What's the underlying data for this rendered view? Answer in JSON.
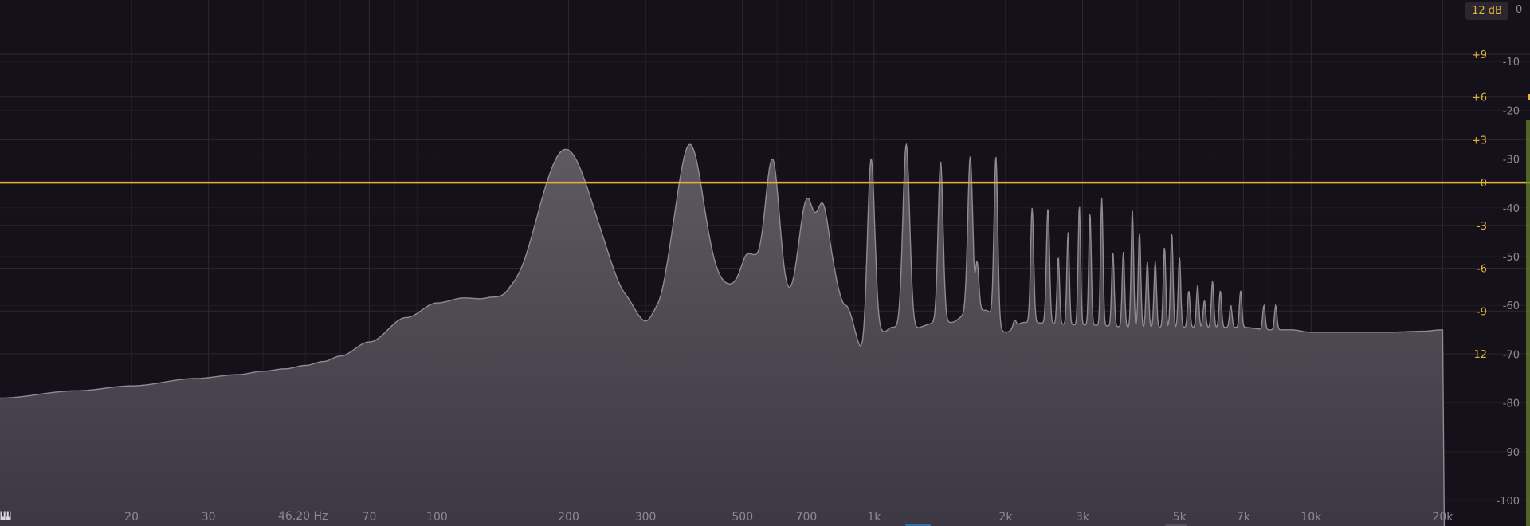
{
  "range_button": {
    "label": "12 dB"
  },
  "cursor_readout": {
    "label": "46.20 Hz"
  },
  "colors": {
    "background": "#15111a",
    "accent": "#e3b23c",
    "spectrum_fill_top": "#5e5a63",
    "spectrum_fill_bottom": "#3c3843",
    "spectrum_line": "#8f8b95",
    "grid": "#2c2932",
    "meter": "#6b8a2a"
  },
  "icons": {
    "piano": "piano-keys-icon"
  },
  "chart_data": {
    "type": "area",
    "x_scale": "log",
    "xlim": [
      10,
      21000
    ],
    "frequency_ticks": [
      {
        "hz": 20,
        "label": "20"
      },
      {
        "hz": 30,
        "label": "30"
      },
      {
        "hz": 70,
        "label": "70"
      },
      {
        "hz": 100,
        "label": "100"
      },
      {
        "hz": 200,
        "label": "200"
      },
      {
        "hz": 300,
        "label": "300"
      },
      {
        "hz": 500,
        "label": "500"
      },
      {
        "hz": 700,
        "label": "700"
      },
      {
        "hz": 1000,
        "label": "1k"
      },
      {
        "hz": 2000,
        "label": "2k"
      },
      {
        "hz": 3000,
        "label": "3k"
      },
      {
        "hz": 5000,
        "label": "5k"
      },
      {
        "hz": 7000,
        "label": "7k"
      },
      {
        "hz": 10000,
        "label": "10k"
      },
      {
        "hz": 20000,
        "label": "20k"
      }
    ],
    "minor_freq_grid": [
      40,
      50,
      60,
      80,
      90,
      400,
      600,
      800,
      900,
      4000,
      6000,
      8000,
      9000
    ],
    "gain_scale": {
      "range": [
        -12,
        12
      ],
      "ticks": [
        {
          "db": 9,
          "label": "+9"
        },
        {
          "db": 6,
          "label": "+6"
        },
        {
          "db": 3,
          "label": "+3"
        },
        {
          "db": 0,
          "label": "0"
        },
        {
          "db": -3,
          "label": "-3"
        },
        {
          "db": -6,
          "label": "-6"
        },
        {
          "db": -9,
          "label": "-9"
        },
        {
          "db": -12,
          "label": "-12"
        }
      ]
    },
    "level_scale": {
      "range": [
        -105,
        0
      ],
      "top_label": "0",
      "ticks": [
        {
          "db": -10,
          "label": "-10"
        },
        {
          "db": -20,
          "label": "-20"
        },
        {
          "db": -30,
          "label": "-30"
        },
        {
          "db": -40,
          "label": "-40"
        },
        {
          "db": -50,
          "label": "-50"
        },
        {
          "db": -60,
          "label": "-60"
        },
        {
          "db": -70,
          "label": "-70"
        },
        {
          "db": -80,
          "label": "-80"
        },
        {
          "db": -90,
          "label": "-90"
        },
        {
          "db": -100,
          "label": "-100"
        }
      ]
    },
    "eq_curve_gain_db": 0,
    "spectrum": {
      "floor_hz": [
        10,
        15,
        20,
        28,
        35,
        40,
        45,
        50,
        55,
        60,
        70,
        85,
        100,
        115,
        130,
        145,
        160,
        180,
        235,
        270,
        300,
        320,
        350,
        500,
        520,
        570,
        600,
        650,
        800,
        860,
        950,
        1050,
        1100,
        1200,
        1400,
        1500,
        1650,
        1800,
        2000,
        2200,
        3000,
        4000,
        5000,
        6000,
        7000,
        8000,
        9000,
        10000,
        12000,
        15000,
        18000,
        20000
      ],
      "floor_db": [
        -79,
        -77.5,
        -76.5,
        -75,
        -74.2,
        -73.5,
        -73,
        -72.3,
        -71.5,
        -70.4,
        -67.5,
        -62.5,
        -59.5,
        -58.5,
        -59,
        -60.5,
        -62,
        -61,
        -58,
        -61,
        -64,
        -62.2,
        -58.5,
        -56,
        -52.5,
        -56,
        -61.5,
        -60.5,
        -55,
        -60,
        -70,
        -65.5,
        -64.5,
        -65,
        -63.5,
        -63.5,
        -61.5,
        -61,
        -65.5,
        -63.5,
        -64,
        -64.5,
        -64.5,
        -64.5,
        -64.5,
        -65,
        -65,
        -65.5,
        -65.5,
        -65.5,
        -65.3,
        -65
      ],
      "peaks": [
        {
          "hz": 197,
          "db": -28,
          "width": 0.09
        },
        {
          "hz": 379,
          "db": -27,
          "width": 0.045
        },
        {
          "hz": 515,
          "db": -49.5,
          "width": 0.022
        },
        {
          "hz": 585,
          "db": -30,
          "width": 0.024
        },
        {
          "hz": 705,
          "db": -38,
          "width": 0.028
        },
        {
          "hz": 760,
          "db": -39,
          "width": 0.022
        },
        {
          "hz": 985,
          "db": -30,
          "width": 0.012
        },
        {
          "hz": 1185,
          "db": -27,
          "width": 0.011
        },
        {
          "hz": 1420,
          "db": -30.5,
          "width": 0.008
        },
        {
          "hz": 1660,
          "db": -29.5,
          "width": 0.008
        },
        {
          "hz": 1720,
          "db": -51,
          "width": 0.006
        },
        {
          "hz": 1900,
          "db": -29.5,
          "width": 0.006
        },
        {
          "hz": 2100,
          "db": -63,
          "width": 0.005
        },
        {
          "hz": 2300,
          "db": -40,
          "width": 0.005
        },
        {
          "hz": 2500,
          "db": -40,
          "width": 0.005
        },
        {
          "hz": 2640,
          "db": -50,
          "width": 0.004
        },
        {
          "hz": 2780,
          "db": -45,
          "width": 0.004
        },
        {
          "hz": 2950,
          "db": -39.5,
          "width": 0.004
        },
        {
          "hz": 3120,
          "db": -41,
          "width": 0.004
        },
        {
          "hz": 3320,
          "db": -38,
          "width": 0.004
        },
        {
          "hz": 3520,
          "db": -49,
          "width": 0.004
        },
        {
          "hz": 3720,
          "db": -49,
          "width": 0.004
        },
        {
          "hz": 3900,
          "db": -40.5,
          "width": 0.004
        },
        {
          "hz": 4050,
          "db": -45,
          "width": 0.004
        },
        {
          "hz": 4220,
          "db": -51,
          "width": 0.004
        },
        {
          "hz": 4400,
          "db": -51,
          "width": 0.004
        },
        {
          "hz": 4620,
          "db": -48,
          "width": 0.004
        },
        {
          "hz": 4800,
          "db": -45,
          "width": 0.004
        },
        {
          "hz": 5000,
          "db": -50,
          "width": 0.004
        },
        {
          "hz": 5250,
          "db": -57,
          "width": 0.004
        },
        {
          "hz": 5500,
          "db": -56,
          "width": 0.004
        },
        {
          "hz": 5700,
          "db": -59,
          "width": 0.004
        },
        {
          "hz": 5950,
          "db": -55,
          "width": 0.004
        },
        {
          "hz": 6200,
          "db": -57,
          "width": 0.004
        },
        {
          "hz": 6550,
          "db": -60,
          "width": 0.004
        },
        {
          "hz": 6900,
          "db": -57,
          "width": 0.004
        },
        {
          "hz": 7800,
          "db": -60,
          "width": 0.004
        },
        {
          "hz": 8300,
          "db": -60,
          "width": 0.004
        }
      ]
    }
  }
}
